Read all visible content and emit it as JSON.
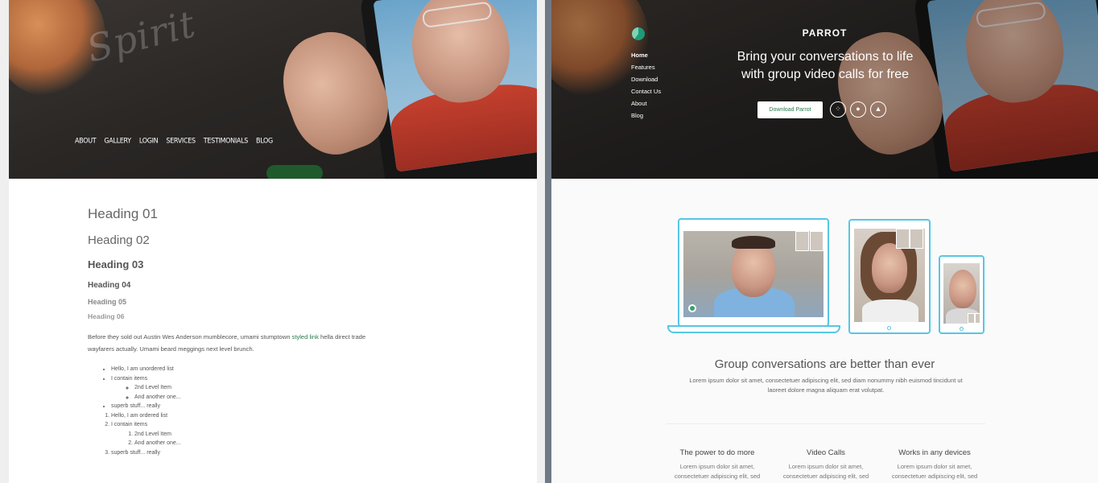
{
  "spirit": {
    "logo_text": "Spirit",
    "nav": [
      "ABOUT",
      "GALLERY",
      "LOGIN",
      "SERVICES",
      "TESTIMONIALS",
      "BLOG"
    ],
    "headings": {
      "h1": "Heading 01",
      "h2": "Heading 02",
      "h3": "Heading 03",
      "h4": "Heading 04",
      "h5": "Heading 05",
      "h6": "Heading 06"
    },
    "paragraph": {
      "before": "Before they sold out Austin Wes Anderson mumblecore, umami stumptown ",
      "link": "styled link",
      "after": " hella direct trade wayfarers actually. Umami beard meggings next level brunch."
    },
    "unordered": [
      "Hello, I am unordered list",
      "I contain items",
      "2nd Level Item",
      "And another one...",
      "superb stuff... really"
    ],
    "ordered": [
      "Hello, I am ordered list",
      "I contain items",
      "2nd Level Item",
      "And another one...",
      "superb stuff... really"
    ]
  },
  "parrot": {
    "brand": "PARROT",
    "nav": [
      "Home",
      "Features",
      "Download",
      "Contact Us",
      "About",
      "Blog"
    ],
    "tagline_line1": "Bring your conversations to life",
    "tagline_line2": "with group video calls for free",
    "download_label": "Download Parrot",
    "store_icons": [
      "blackberry-icon",
      "apple-icon",
      "android-icon"
    ],
    "section_title": "Group conversations are better than ever",
    "section_text": "Lorem ipsum dolor sit amet, consectetuer adipiscing elit, sed diam nonummy nibh euismod tincidunt ut laoreet dolore magna aliquam erat volutpat.",
    "features": [
      {
        "title": "The power to do more",
        "text": "Lorem ipsum dolor sit amet, consectetuer adipiscing elit, sed"
      },
      {
        "title": "Video Calls",
        "text": "Lorem ipsum dolor sit amet, consectetuer adipiscing elit, sed"
      },
      {
        "title": "Works in any devices",
        "text": "Lorem ipsum dolor sit amet, consectetuer adipiscing elit, sed"
      }
    ]
  },
  "colors": {
    "accent_green": "#2a7a4e",
    "device_outline": "#56c6e6",
    "divider": "#6f7a86"
  }
}
